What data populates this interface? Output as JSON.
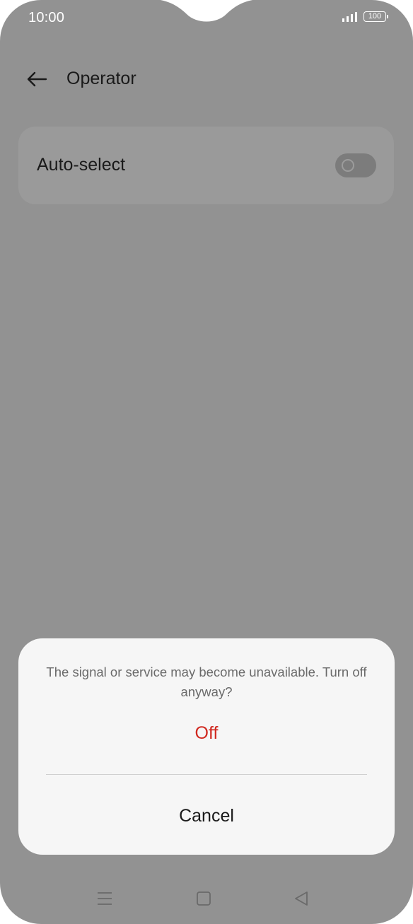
{
  "status_bar": {
    "time": "10:00",
    "battery": "100",
    "icons": [
      "signal-icon",
      "battery-icon"
    ]
  },
  "header": {
    "title": "Operator",
    "back_icon": "arrow-left-icon"
  },
  "settings": {
    "auto_select_label": "Auto-select",
    "auto_select_on": false
  },
  "dialog": {
    "message": "The signal or service may become unavailable. Turn off anyway?",
    "confirm_label": "Off",
    "cancel_label": "Cancel",
    "confirm_color": "#d0281f"
  },
  "nav_bar": {
    "icons": [
      "menu-icon",
      "home-icon",
      "back-triangle-icon"
    ]
  },
  "colors": {
    "scrim": "#929292",
    "dialog_bg": "#f6f6f6"
  }
}
